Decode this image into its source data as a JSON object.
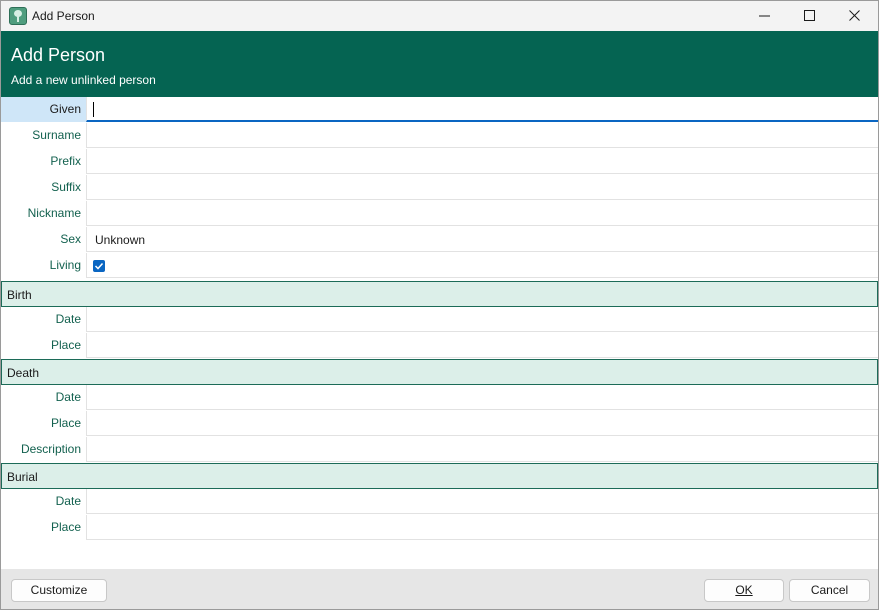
{
  "window": {
    "title": "Add Person",
    "icon": "family-tree-app-icon"
  },
  "banner": {
    "title": "Add Person",
    "subtitle": "Add a new unlinked person",
    "color": "#056452"
  },
  "fields": {
    "given": {
      "label": "Given",
      "value": ""
    },
    "surname": {
      "label": "Surname",
      "value": ""
    },
    "prefix": {
      "label": "Prefix",
      "value": ""
    },
    "suffix": {
      "label": "Suffix",
      "value": ""
    },
    "nickname": {
      "label": "Nickname",
      "value": ""
    },
    "sex": {
      "label": "Sex",
      "value": "Unknown"
    },
    "living": {
      "label": "Living",
      "checked": true
    }
  },
  "sections": {
    "birth": {
      "title": "Birth",
      "date_label": "Date",
      "place_label": "Place"
    },
    "death": {
      "title": "Death",
      "date_label": "Date",
      "place_label": "Place",
      "description_label": "Description"
    },
    "burial": {
      "title": "Burial",
      "date_label": "Date",
      "place_label": "Place"
    }
  },
  "footer": {
    "customize_label": "Customize",
    "ok_label": "OK",
    "cancel_label": "Cancel"
  },
  "colors": {
    "accent": "#0a66c2",
    "label_text": "#13614f",
    "section_bg": "#dcefe9"
  }
}
